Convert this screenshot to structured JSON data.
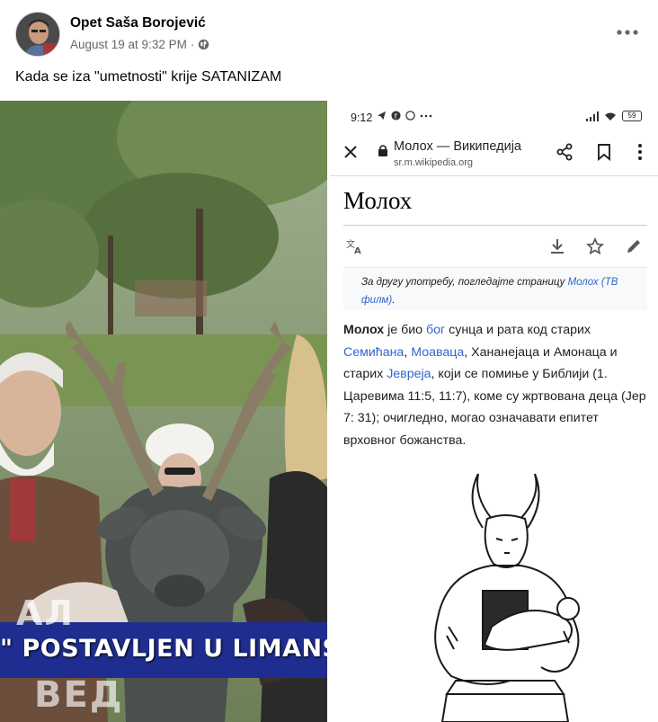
{
  "post": {
    "author": "Opet Saša Borojević",
    "timestamp": "August 19 at 9:32 PM",
    "separator": "·",
    "privacy_icon": "globe-icon",
    "more_icon": "more-options-icon",
    "caption": "Kada se iza \"umetnosti\" krije SATANIZAM"
  },
  "video": {
    "ticker_text": "\" POSTAVLJEN U LIMANSKO",
    "ghost_top": "АЛ",
    "ghost_bottom": "ВЕД",
    "ticker_color": "#1e2d8f"
  },
  "phone": {
    "status": {
      "time": "9:12",
      "battery": "59"
    },
    "browser": {
      "page_title": "Молох — Википедија",
      "url": "sr.m.wikipedia.org"
    },
    "article": {
      "title": "Молох",
      "hatnote": {
        "prefix": "За другу употребу, погледајте страницу ",
        "link": "Молох (ТВ филм)",
        "suffix": "."
      },
      "paragraph": {
        "bold": "Молох",
        "t1": " је био ",
        "l1": "бог",
        "t2": " сунца и рата код старих ",
        "l2": "Семићана",
        "t3": ", ",
        "l3": "Моаваца",
        "t4": ", Хананејаца и Амонаца и старих ",
        "l4": "Јевреја",
        "t5": ", који се помиње у Библији (1. Царевима 11:5, 11:7), коме су жртвована деца (Јер 7: 31); очигледно, могао означавати епитет врховног божанства."
      }
    },
    "link_color": "#3366cc"
  }
}
